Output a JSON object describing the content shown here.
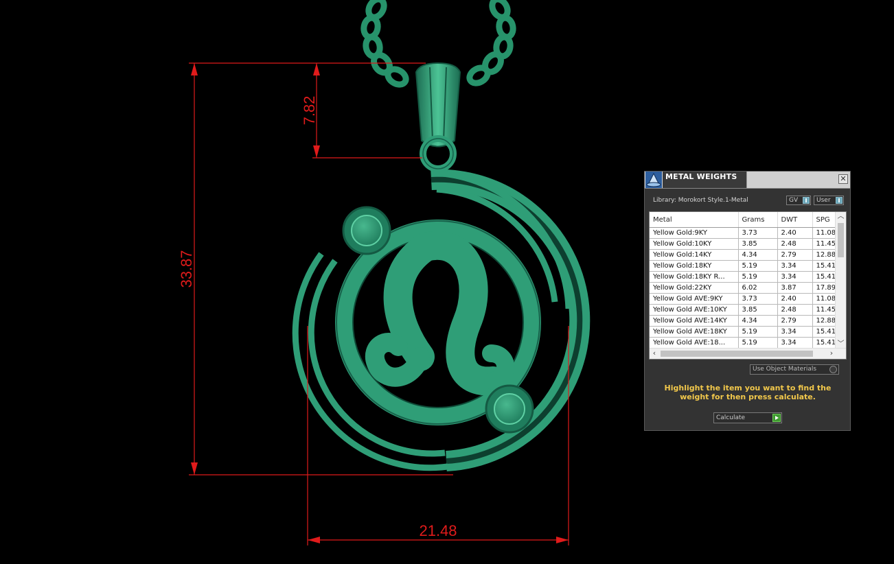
{
  "viewport": {
    "dimensions": {
      "height": "33.87",
      "bail_height": "7.82",
      "width": "21.48"
    },
    "colors": {
      "model": "#2f9e77",
      "model_dark": "#17614a",
      "model_light": "#5fd0a4",
      "dimension": "#e01b1b"
    }
  },
  "panel": {
    "title": "METAL WEIGHTS",
    "close_symbol": "✕",
    "library_label": "Library: Morokort Style.1-Metal",
    "toggles": {
      "gv": "GV",
      "user": "User"
    },
    "table": {
      "columns": [
        "Metal",
        "Grams",
        "DWT",
        "SPG"
      ],
      "rows": [
        [
          "Yellow Gold:9KY",
          "3.73",
          "2.40",
          "11.08"
        ],
        [
          "Yellow Gold:10KY",
          "3.85",
          "2.48",
          "11.45"
        ],
        [
          "Yellow Gold:14KY",
          "4.34",
          "2.79",
          "12.88"
        ],
        [
          "Yellow Gold:18KY",
          "5.19",
          "3.34",
          "15.41"
        ],
        [
          "Yellow Gold:18KY R...",
          "5.19",
          "3.34",
          "15.41"
        ],
        [
          "Yellow Gold:22KY",
          "6.02",
          "3.87",
          "17.89"
        ],
        [
          "Yellow Gold AVE:9KY",
          "3.73",
          "2.40",
          "11.08"
        ],
        [
          "Yellow Gold AVE:10KY",
          "3.85",
          "2.48",
          "11.45"
        ],
        [
          "Yellow Gold AVE:14KY",
          "4.34",
          "2.79",
          "12.88"
        ],
        [
          "Yellow Gold AVE:18KY",
          "5.19",
          "3.34",
          "15.41"
        ],
        [
          "Yellow Gold AVE:18...",
          "5.19",
          "3.34",
          "15.41"
        ]
      ]
    },
    "use_object_materials": "Use Object Materials",
    "hint": "Highlight the item you want to find the weight for then press calculate.",
    "calculate": "Calculate",
    "colors": {
      "hint": "#f2c84b",
      "accent_go": "#3f9b30",
      "toggle": "#6aa6b8"
    }
  }
}
